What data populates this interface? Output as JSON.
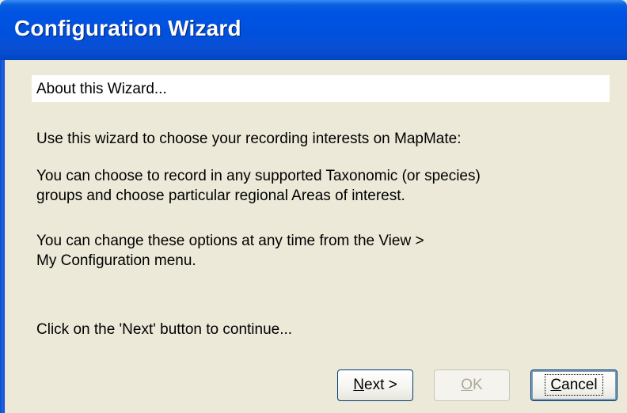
{
  "window": {
    "title": "Configuration Wizard"
  },
  "content": {
    "heading": "About this Wizard...",
    "paragraphs": [
      "Use this wizard to choose your recording interests on MapMate:",
      "You can choose to record in any supported Taxonomic (or species)",
      "groups and choose particular regional Areas of interest.",
      "You can change these options at any time from the View >",
      "My Configuration menu.",
      "Click on the 'Next' button to continue..."
    ]
  },
  "buttons": {
    "next": {
      "mnemonic": "N",
      "rest": "ext >"
    },
    "ok": {
      "mnemonic": "O",
      "rest": "K",
      "enabled": false
    },
    "cancel": {
      "mnemonic": "C",
      "rest": "ancel",
      "focused": true
    }
  },
  "colors": {
    "titlebar": "#0054e3",
    "dialog_bg": "#ece9d8",
    "heading_bg": "#ffffff"
  }
}
